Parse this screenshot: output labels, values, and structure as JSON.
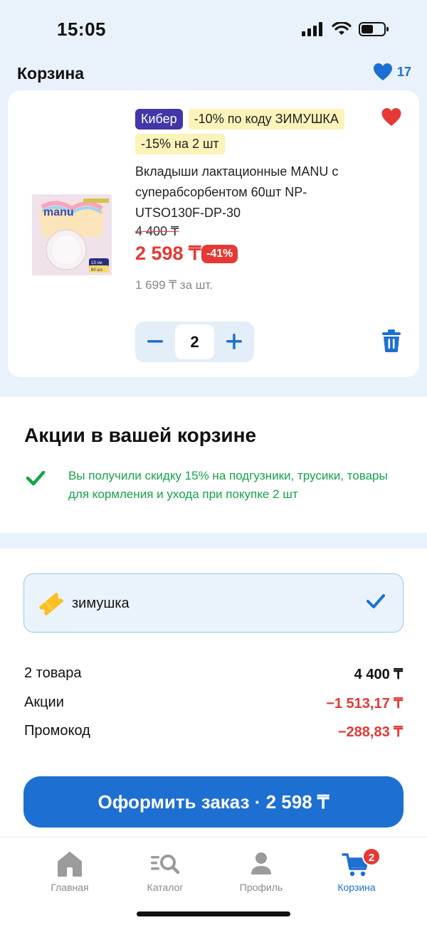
{
  "status": {
    "time": "15:05"
  },
  "header": {
    "title": "Корзина",
    "favorites_count": "17"
  },
  "product": {
    "tag_kiber": "Кибер",
    "tag_code": "-10% по коду ЗИМУШКА",
    "tag_bulk": "-15% на 2 шт",
    "name": "Вкладыши лактационные MANU с суперабсорбентом 60шт NP-UTSO130F-DP-30",
    "old_price": "4 400 ₸",
    "new_price": "2 598 ₸",
    "discount": "-41%",
    "unit_price": "1 699 ₸ за шт.",
    "quantity": "2",
    "image_brand": "manu",
    "image_size": "13 см",
    "image_count": "60 шт."
  },
  "promos": {
    "title": "Акции в вашей корзине",
    "message": "Вы получили скидку 15% на подгузники, трусики, товары для кормления и ухода при покупке 2 шт"
  },
  "promo_code": {
    "value": "зимушка"
  },
  "summary": {
    "items_label": "2 товара",
    "items_value": "4 400 ₸",
    "promos_label": "Акции",
    "promos_value": "−1 513,17 ₸",
    "code_label": "Промокод",
    "code_value": "−288,83 ₸"
  },
  "checkout": {
    "label": "Оформить заказ · 2 598 ₸"
  },
  "tabs": [
    {
      "label": "Главная",
      "icon": "home-icon"
    },
    {
      "label": "Каталог",
      "icon": "catalog-search-icon"
    },
    {
      "label": "Профиль",
      "icon": "profile-icon"
    },
    {
      "label": "Корзина",
      "icon": "cart-icon",
      "badge": "2"
    }
  ],
  "colors": {
    "accent": "#1d6fd2",
    "sale": "#e53935",
    "success": "#16a34a",
    "kiber": "#4236a8",
    "highlight": "#fbf3b9"
  }
}
